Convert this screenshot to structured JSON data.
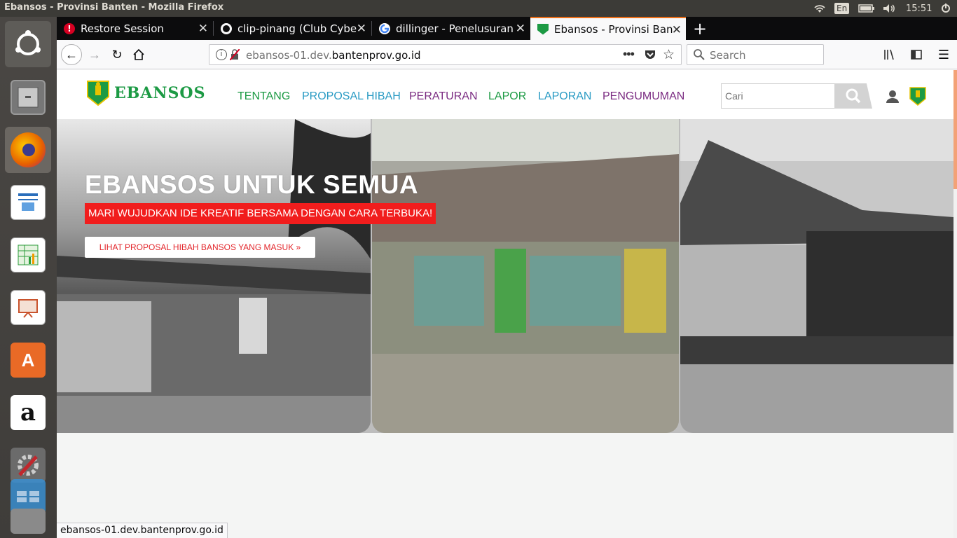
{
  "system": {
    "window_title": "Ebansos - Provinsi Banten - Mozilla Firefox",
    "keyboard": "En",
    "clock": "15:51"
  },
  "launcher": {
    "items": [
      {
        "name": "ubuntu-dash",
        "color": "#5a5a5a"
      },
      {
        "name": "files",
        "color": "#6b6b6b"
      },
      {
        "name": "firefox",
        "color": "#e66000"
      },
      {
        "name": "libreoffice-writer",
        "color": "#2a6ebb"
      },
      {
        "name": "libreoffice-calc",
        "color": "#2d9d3c"
      },
      {
        "name": "libreoffice-impress",
        "color": "#c9532d"
      },
      {
        "name": "ubuntu-software",
        "color": "#e96a26"
      },
      {
        "name": "amazon",
        "color": "#ffffff"
      },
      {
        "name": "system-settings",
        "color": "#6b6b6b"
      },
      {
        "name": "workspace-switcher",
        "color": "#3a8fd0"
      }
    ]
  },
  "browser": {
    "tabs": [
      {
        "label": "Restore Session",
        "icon": "warning-icon"
      },
      {
        "label": "clip-pinang (Club Cyber I",
        "icon": "github-icon"
      },
      {
        "label": "dillinger - Penelusuran G",
        "icon": "google-icon"
      },
      {
        "label": "Ebansos - Provinsi Bante",
        "icon": "banten-icon",
        "active": true
      }
    ],
    "new_tab": "+",
    "url_prefix": "ebansos-01.dev.",
    "url_domain": "bantenprov.go.id",
    "search_placeholder": "Search",
    "status_url": "ebansos-01.dev.bantenprov.go.id"
  },
  "site": {
    "logo_text": "EBANSOS",
    "menu": [
      {
        "label": "TENTANG",
        "color": "#1c9a44"
      },
      {
        "label": "PROPOSAL HIBAH",
        "color": "#2a9bc4"
      },
      {
        "label": "PERATURAN",
        "color": "#7b2c82"
      },
      {
        "label": "LAPOR",
        "color": "#1c9a44"
      },
      {
        "label": "LAPORAN",
        "color": "#2a9bc4"
      },
      {
        "label": "PENGUMUMAN",
        "color": "#7b2c82"
      }
    ],
    "search_placeholder": "Cari",
    "hero": {
      "title": "EBANSOS UNTUK SEMUA",
      "tagline": "MARI WUJUDKAN IDE KREATIF BERSAMA DENGAN CARA TERBUKA!",
      "button": "LIHAT PROPOSAL HIBAH BANSOS YANG MASUK »"
    }
  }
}
